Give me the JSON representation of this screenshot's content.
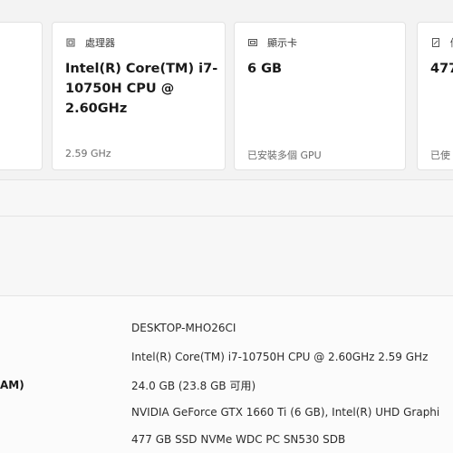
{
  "cards": [
    {
      "label": "",
      "value": "",
      "sub": ""
    },
    {
      "label": "處理器",
      "icon": "processor-icon",
      "value": "Intel(R) Core(TM) i7-10750H CPU @ 2.60GHz",
      "sub": "2.59 GHz"
    },
    {
      "label": "顯示卡",
      "icon": "graphics-card-icon",
      "value": "6 GB",
      "sub": "已安裝多個 GPU"
    },
    {
      "label": "儲",
      "icon": "storage-icon",
      "value": "477",
      "sub": "已使"
    }
  ],
  "specs": {
    "ram_label": "AM)",
    "rows": [
      "DESKTOP-MHO26CI",
      "Intel(R) Core(TM) i7-10750H CPU @ 2.60GHz   2.59 GHz",
      "24.0 GB (23.8 GB 可用)",
      "NVIDIA GeForce GTX 1660 Ti (6 GB), Intel(R) UHD Graphi",
      "477 GB SSD NVMe WDC PC SN530 SDB"
    ]
  }
}
